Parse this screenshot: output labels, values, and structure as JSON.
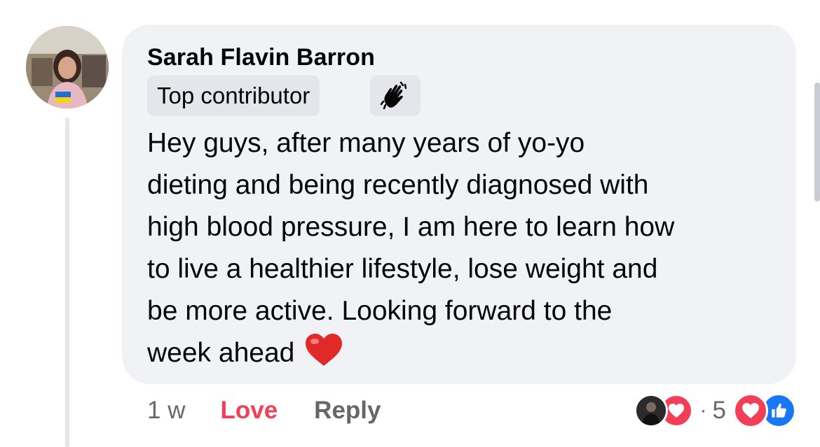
{
  "comment": {
    "author": "Sarah Flavin Barron",
    "badge": "Top contributor",
    "badge_icon": "waving-hand-icon",
    "text": "Hey guys, after many years of yo-yo\ndieting and being recently diagnosed with\nhigh blood pressure, I am here to learn how\nto live a healthier lifestyle, lose weight and\nbe more active. Looking forward to the\nweek ahead",
    "emoji": "red-heart-emoji"
  },
  "actions": {
    "time": "1 w",
    "love_label": "Love",
    "reply_label": "Reply"
  },
  "reactions": {
    "separator": "·",
    "count": "5",
    "types": [
      "love",
      "like"
    ]
  },
  "colors": {
    "bubble": "#f0f2f5",
    "love": "#f33e58",
    "like": "#1877f2",
    "secondary_text": "#65676b"
  }
}
